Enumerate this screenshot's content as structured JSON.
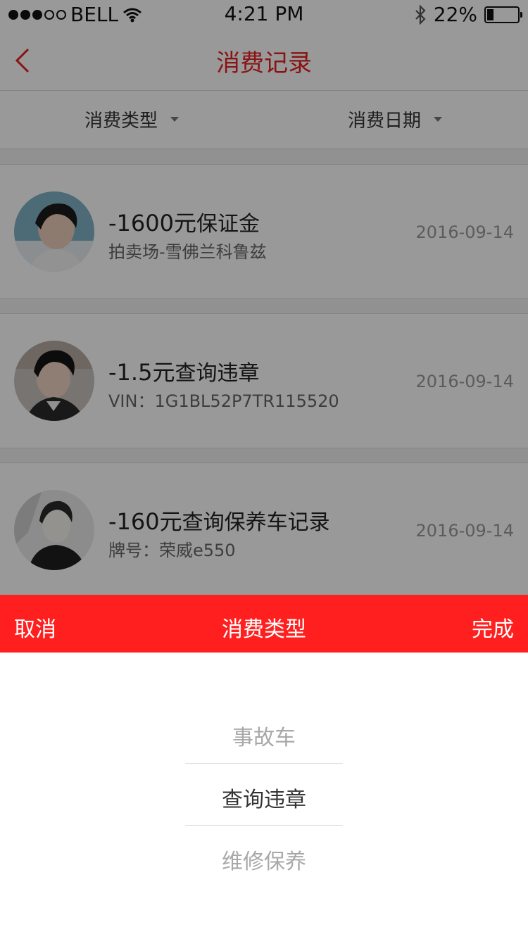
{
  "status_bar": {
    "carrier": "BELL",
    "time": "4:21 PM",
    "battery_percent": "22%",
    "battery_level": 0.22
  },
  "nav": {
    "title": "消费记录",
    "title_color": "#e52221"
  },
  "filters": {
    "type_label": "消费类型",
    "date_label": "消费日期"
  },
  "records": [
    {
      "amount": "-1600元",
      "desc": "保证金",
      "sub": "拍卖场-雪佛兰科鲁兹",
      "date": "2016-09-14"
    },
    {
      "amount": "-1.5元",
      "desc": "查询违章",
      "sub": "VIN：1G1BL52P7TR115520",
      "date": "2016-09-14"
    },
    {
      "amount": "-160元",
      "desc": "查询保养车记录",
      "sub": "牌号：荣威e550",
      "date": "2016-09-14"
    }
  ],
  "picker": {
    "cancel_label": "取消",
    "title": "消费类型",
    "done_label": "完成",
    "bar_color": "#ff1f1f",
    "options": [
      "事故车",
      "查询违章",
      "维修保养"
    ],
    "selected": "查询违章"
  }
}
